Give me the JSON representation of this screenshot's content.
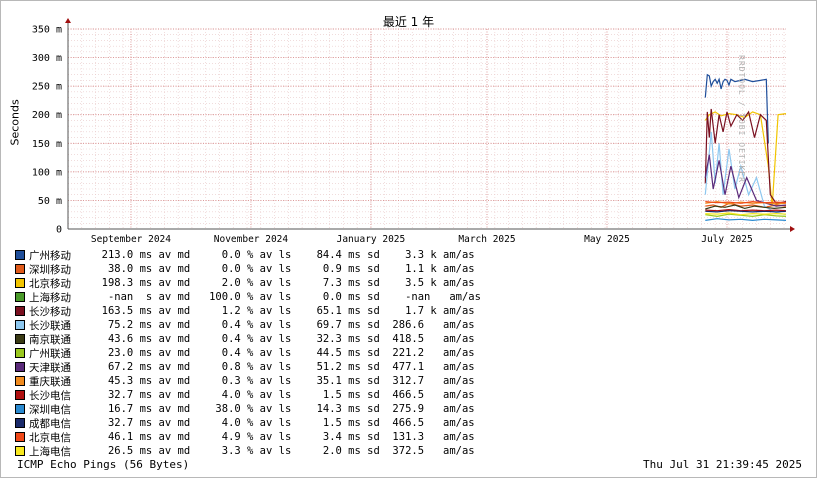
{
  "title": "最近 1 年",
  "watermark": "RRDTOOL / TOBI OETIKER",
  "chart_data": {
    "type": "line",
    "title": "最近 1 年",
    "ylabel": "Seconds",
    "y_unit": "m",
    "ylim": [
      0,
      350
    ],
    "y_ticks": [
      {
        "value": 0,
        "label": "0"
      },
      {
        "value": 50,
        "label": "50 m"
      },
      {
        "value": 100,
        "label": "100 m"
      },
      {
        "value": 150,
        "label": "150 m"
      },
      {
        "value": 200,
        "label": "200 m"
      },
      {
        "value": 250,
        "label": "250 m"
      },
      {
        "value": 300,
        "label": "300 m"
      },
      {
        "value": 350,
        "label": "350 m"
      }
    ],
    "xlim": [
      "2024-07-31",
      "2025-07-31"
    ],
    "x_ticks": [
      {
        "date": "2024-09-01",
        "label": "September 2024"
      },
      {
        "date": "2024-11-01",
        "label": "November 2024"
      },
      {
        "date": "2025-01-01",
        "label": "January 2025"
      },
      {
        "date": "2025-03-01",
        "label": "March 2025"
      },
      {
        "date": "2025-05-01",
        "label": "May 2025"
      },
      {
        "date": "2025-07-01",
        "label": "July 2025"
      }
    ],
    "grid": true,
    "legend_position": "bottom",
    "series": [
      {
        "name": "广州移动",
        "color": "#1f4e9a",
        "stats": "  213.0 ms av md     0.0 % av ls    84.4 ms sd    3.3 k am/as",
        "points": [
          [
            "2025-06-20",
            230
          ],
          [
            "2025-06-21",
            270
          ],
          [
            "2025-06-22",
            268
          ],
          [
            "2025-06-23",
            250
          ],
          [
            "2025-06-24",
            258
          ],
          [
            "2025-06-25",
            262
          ],
          [
            "2025-06-26",
            255
          ],
          [
            "2025-06-27",
            262
          ],
          [
            "2025-06-28",
            245
          ],
          [
            "2025-06-29",
            258
          ],
          [
            "2025-06-30",
            262
          ],
          [
            "2025-07-01",
            260
          ],
          [
            "2025-07-02",
            252
          ],
          [
            "2025-07-03",
            262
          ],
          [
            "2025-07-05",
            258
          ],
          [
            "2025-07-08",
            260
          ],
          [
            "2025-07-10",
            262
          ],
          [
            "2025-07-14",
            258
          ],
          [
            "2025-07-18",
            260
          ],
          [
            "2025-07-21",
            262
          ],
          [
            "2025-07-22",
            150
          ]
        ]
      },
      {
        "name": "深圳移动",
        "color": "#e05a1a",
        "stats": "   38.0 ms av md     0.0 % av ls     0.9 ms sd    1.1 k am/as",
        "points": [
          [
            "2025-06-20",
            40
          ],
          [
            "2025-06-24",
            42
          ],
          [
            "2025-06-28",
            38
          ],
          [
            "2025-07-02",
            45
          ],
          [
            "2025-07-08",
            40
          ],
          [
            "2025-07-14",
            42
          ],
          [
            "2025-07-20",
            38
          ],
          [
            "2025-07-26",
            42
          ],
          [
            "2025-07-31",
            40
          ]
        ]
      },
      {
        "name": "北京移动",
        "color": "#f2c500",
        "stats": "  198.3 ms av md     2.0 % av ls     7.3 ms sd    3.5 k am/as",
        "points": [
          [
            "2025-06-20",
            190
          ],
          [
            "2025-06-22",
            200
          ],
          [
            "2025-06-25",
            205
          ],
          [
            "2025-06-28",
            198
          ],
          [
            "2025-07-02",
            202
          ],
          [
            "2025-07-06",
            200
          ],
          [
            "2025-07-10",
            195
          ],
          [
            "2025-07-14",
            205
          ],
          [
            "2025-07-18",
            200
          ],
          [
            "2025-07-22",
            110
          ],
          [
            "2025-07-24",
            40
          ],
          [
            "2025-07-27",
            200
          ],
          [
            "2025-07-31",
            202
          ]
        ]
      },
      {
        "name": "上海移动",
        "color": "#4a9a2a",
        "stats": "   -nan  s av md   100.0 % av ls     0.0 ms sd    -nan   am/as",
        "points": []
      },
      {
        "name": "长沙移动",
        "color": "#7a1020",
        "stats": "  163.5 ms av md     1.2 % av ls    65.1 ms sd    1.7 k am/as",
        "points": [
          [
            "2025-06-20",
            80
          ],
          [
            "2025-06-21",
            205
          ],
          [
            "2025-06-22",
            160
          ],
          [
            "2025-06-23",
            210
          ],
          [
            "2025-06-25",
            150
          ],
          [
            "2025-06-27",
            200
          ],
          [
            "2025-06-29",
            170
          ],
          [
            "2025-07-01",
            205
          ],
          [
            "2025-07-03",
            180
          ],
          [
            "2025-07-06",
            200
          ],
          [
            "2025-07-09",
            190
          ],
          [
            "2025-07-12",
            205
          ],
          [
            "2025-07-15",
            160
          ],
          [
            "2025-07-18",
            200
          ],
          [
            "2025-07-21",
            190
          ],
          [
            "2025-07-23",
            60
          ],
          [
            "2025-07-26",
            45
          ],
          [
            "2025-07-31",
            48
          ]
        ]
      },
      {
        "name": "长沙联通",
        "color": "#8ec8f0",
        "stats": "   75.2 ms av md     0.4 % av ls    69.7 ms sd  286.6   am/as",
        "points": [
          [
            "2025-06-20",
            60
          ],
          [
            "2025-06-23",
            170
          ],
          [
            "2025-06-25",
            80
          ],
          [
            "2025-06-27",
            150
          ],
          [
            "2025-06-29",
            60
          ],
          [
            "2025-07-02",
            140
          ],
          [
            "2025-07-05",
            70
          ],
          [
            "2025-07-08",
            110
          ],
          [
            "2025-07-12",
            60
          ],
          [
            "2025-07-16",
            90
          ],
          [
            "2025-07-20",
            40
          ],
          [
            "2025-07-25",
            30
          ],
          [
            "2025-07-31",
            25
          ]
        ]
      },
      {
        "name": "南京联通",
        "color": "#3a3a14",
        "stats": "   43.6 ms av md     0.4 % av ls    32.3 ms sd  418.5   am/as",
        "points": [
          [
            "2025-06-20",
            35
          ],
          [
            "2025-06-25",
            40
          ],
          [
            "2025-06-30",
            38
          ],
          [
            "2025-07-05",
            42
          ],
          [
            "2025-07-10",
            36
          ],
          [
            "2025-07-15",
            40
          ],
          [
            "2025-07-20",
            38
          ],
          [
            "2025-07-25",
            36
          ],
          [
            "2025-07-31",
            38
          ]
        ]
      },
      {
        "name": "广州联通",
        "color": "#9ac81e",
        "stats": "   23.0 ms av md     0.4 % av ls    44.5 ms sd  221.2   am/as",
        "points": [
          [
            "2025-06-20",
            25
          ],
          [
            "2025-06-26",
            22
          ],
          [
            "2025-07-02",
            26
          ],
          [
            "2025-07-08",
            24
          ],
          [
            "2025-07-14",
            22
          ],
          [
            "2025-07-20",
            25
          ],
          [
            "2025-07-26",
            23
          ],
          [
            "2025-07-31",
            22
          ]
        ]
      },
      {
        "name": "天津联通",
        "color": "#5a2a7a",
        "stats": "   67.2 ms av md     0.8 % av ls    51.2 ms sd  477.1   am/as",
        "points": [
          [
            "2025-06-20",
            90
          ],
          [
            "2025-06-22",
            130
          ],
          [
            "2025-06-24",
            70
          ],
          [
            "2025-06-27",
            120
          ],
          [
            "2025-06-30",
            60
          ],
          [
            "2025-07-03",
            110
          ],
          [
            "2025-07-07",
            55
          ],
          [
            "2025-07-11",
            90
          ],
          [
            "2025-07-16",
            50
          ],
          [
            "2025-07-21",
            45
          ],
          [
            "2025-07-26",
            40
          ],
          [
            "2025-07-31",
            42
          ]
        ]
      },
      {
        "name": "重庆联通",
        "color": "#f08a1e",
        "stats": "   45.3 ms av md     0.3 % av ls    35.1 ms sd  312.7   am/as",
        "points": [
          [
            "2025-06-20",
            45
          ],
          [
            "2025-06-26",
            48
          ],
          [
            "2025-07-02",
            44
          ],
          [
            "2025-07-08",
            47
          ],
          [
            "2025-07-14",
            45
          ],
          [
            "2025-07-20",
            46
          ],
          [
            "2025-07-26",
            44
          ],
          [
            "2025-07-31",
            45
          ]
        ]
      },
      {
        "name": "长沙电信",
        "color": "#b01010",
        "stats": "   32.7 ms av md     4.0 % av ls     1.5 ms sd  466.5   am/as",
        "points": [
          [
            "2025-06-20",
            33
          ],
          [
            "2025-06-26",
            32
          ],
          [
            "2025-07-02",
            34
          ],
          [
            "2025-07-08",
            32
          ],
          [
            "2025-07-14",
            33
          ],
          [
            "2025-07-20",
            32
          ],
          [
            "2025-07-26",
            33
          ],
          [
            "2025-07-31",
            32
          ]
        ]
      },
      {
        "name": "深圳电信",
        "color": "#2a8ad0",
        "stats": "   16.7 ms av md    38.0 % av ls    14.3 ms sd  275.9   am/as",
        "points": [
          [
            "2025-06-20",
            15
          ],
          [
            "2025-06-26",
            18
          ],
          [
            "2025-07-02",
            16
          ],
          [
            "2025-07-08",
            17
          ],
          [
            "2025-07-14",
            15
          ],
          [
            "2025-07-20",
            17
          ],
          [
            "2025-07-26",
            16
          ],
          [
            "2025-07-31",
            15
          ]
        ]
      },
      {
        "name": "成都电信",
        "color": "#1a2a6a",
        "stats": "   32.7 ms av md     4.0 % av ls     1.5 ms sd  466.5   am/as",
        "points": [
          [
            "2025-06-20",
            31
          ],
          [
            "2025-06-26",
            30
          ],
          [
            "2025-07-02",
            32
          ],
          [
            "2025-07-08",
            31
          ],
          [
            "2025-07-14",
            30
          ],
          [
            "2025-07-20",
            31
          ],
          [
            "2025-07-26",
            30
          ],
          [
            "2025-07-31",
            31
          ]
        ]
      },
      {
        "name": "北京电信",
        "color": "#f04818",
        "stats": "   46.1 ms av md     4.9 % av ls     3.4 ms sd  131.3   am/as",
        "points": [
          [
            "2025-06-20",
            48
          ],
          [
            "2025-06-26",
            46
          ],
          [
            "2025-07-02",
            47
          ],
          [
            "2025-07-08",
            45
          ],
          [
            "2025-07-14",
            48
          ],
          [
            "2025-07-20",
            46
          ],
          [
            "2025-07-26",
            47
          ],
          [
            "2025-07-31",
            46
          ]
        ]
      },
      {
        "name": "上海电信",
        "color": "#f8e820",
        "stats": "   26.5 ms av md     3.3 % av ls     2.0 ms sd  372.5   am/as",
        "points": [
          [
            "2025-06-20",
            27
          ],
          [
            "2025-06-26",
            26
          ],
          [
            "2025-07-02",
            28
          ],
          [
            "2025-07-08",
            25
          ],
          [
            "2025-07-14",
            27
          ],
          [
            "2025-07-20",
            26
          ],
          [
            "2025-07-26",
            27
          ],
          [
            "2025-07-31",
            26
          ]
        ]
      }
    ]
  },
  "footer": {
    "left": "ICMP Echo Pings (56 Bytes)",
    "right": "Thu Jul 31 21:39:45 2025"
  }
}
